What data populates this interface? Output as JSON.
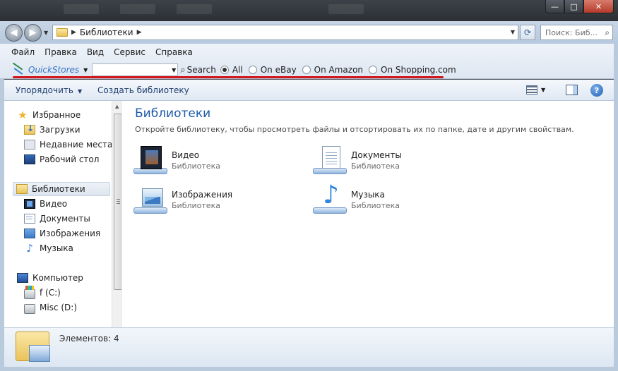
{
  "window": {
    "controls": {
      "minimize": "—",
      "maximize": "□",
      "close": "✕"
    }
  },
  "nav": {
    "back_icon": "◀",
    "forward_icon": "▶",
    "address_crumb": "Библиотеки",
    "search_placeholder": "Поиск: Биб..."
  },
  "menu": {
    "items": [
      "Файл",
      "Правка",
      "Вид",
      "Сервис",
      "Справка"
    ]
  },
  "quickstores": {
    "name": "QuickStores",
    "search_label": "Search",
    "options": [
      {
        "label": "All",
        "selected": true
      },
      {
        "label": "On eBay",
        "selected": false
      },
      {
        "label": "On Amazon",
        "selected": false
      },
      {
        "label": "On Shopping.com",
        "selected": false
      }
    ],
    "annotation_color": "#d0161b"
  },
  "toolbar": {
    "organize_label": "Упорядочить",
    "new_library_label": "Создать библиотеку",
    "help_label": "?"
  },
  "sidebar": {
    "favorites": {
      "label": "Избранное",
      "items": [
        "Загрузки",
        "Недавние места",
        "Рабочий стол"
      ]
    },
    "libraries": {
      "label": "Библиотеки",
      "items": [
        "Видео",
        "Документы",
        "Изображения",
        "Музыка"
      ]
    },
    "computer": {
      "label": "Компьютер",
      "items": [
        "f (C:)",
        "Misc (D:)"
      ]
    }
  },
  "main": {
    "title": "Библиотеки",
    "description": "Откройте библиотеку, чтобы просмотреть файлы и отсортировать их по папке, дате и другим свойствам.",
    "libraries": [
      {
        "name": "Видео",
        "type": "Библиотека"
      },
      {
        "name": "Документы",
        "type": "Библиотека"
      },
      {
        "name": "Изображения",
        "type": "Библиотека"
      },
      {
        "name": "Музыка",
        "type": "Библиотека"
      }
    ]
  },
  "details": {
    "count_text": "Элементов: 4"
  }
}
